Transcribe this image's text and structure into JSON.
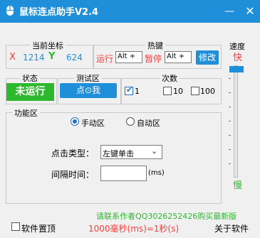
{
  "window": {
    "title": "鼠标连点助手V2.4",
    "minimize": "—",
    "close": "✕"
  },
  "coordinates": {
    "title": "当前坐标",
    "x_label": "X",
    "x_value": "1214",
    "y_label": "Y",
    "y_value": "624"
  },
  "hotkeys": {
    "title": "热键",
    "run_label": "运行",
    "run_value": "Alt +",
    "pause_label": "暂停",
    "pause_value": "Alt +",
    "modify_button": "修改"
  },
  "status": {
    "title": "状态",
    "value": "未运行"
  },
  "test_area": {
    "title": "测试区",
    "button": "点⊙我"
  },
  "count": {
    "title": "次数",
    "options": [
      {
        "label": "1",
        "checked": true
      },
      {
        "label": "10",
        "checked": false
      },
      {
        "label": "100",
        "checked": false
      }
    ]
  },
  "speed": {
    "title": "速度",
    "fast": "快",
    "slow": "慢",
    "level": 1.0
  },
  "function_area": {
    "title": "功能区",
    "manual_label": "手动区",
    "manual_selected": true,
    "auto_label": "自动区",
    "click_type_label": "点击类型：",
    "click_type_value": "左键单击",
    "interval_label": "间隔时间：",
    "interval_value": "",
    "interval_unit": "(ms)"
  },
  "footer": {
    "contact": "请联系作者QQ3026252426购买最新版",
    "pin_label": "软件置顶",
    "rate": "1000毫秒(ms)=1秒(s)",
    "about": "关于软件"
  },
  "colors": {
    "accent": "#1e8fd8",
    "red": "#ff3b3b",
    "green": "#2eb82e"
  }
}
